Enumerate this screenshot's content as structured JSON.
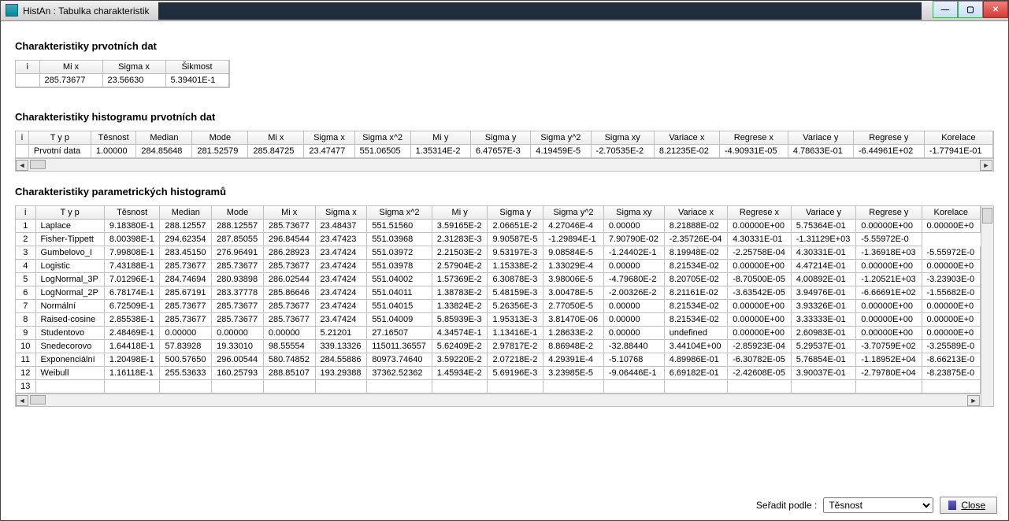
{
  "window": {
    "title": "HistAn : Tabulka charakteristik"
  },
  "sections": {
    "sec1_title": "Charakteristiky prvotních dat",
    "sec2_title": "Charakteristiky histogramu prvotních dat",
    "sec3_title": "Charakteristiky parametrických histogramů"
  },
  "table1": {
    "headers": [
      "i",
      "Mi x",
      "Sigma x",
      "Šikmost"
    ],
    "row": [
      "",
      "285.73677",
      "23.56630",
      "5.39401E-1"
    ]
  },
  "table2": {
    "headers": [
      "i",
      "T y p",
      "Těsnost",
      "Median",
      "Mode",
      "Mi x",
      "Sigma x",
      "Sigma x^2",
      "Mi y",
      "Sigma y",
      "Sigma y^2",
      "Sigma xy",
      "Variace x",
      "Regrese x",
      "Variace y",
      "Regrese y",
      "Korelace"
    ],
    "row": [
      "",
      "Prvotní data",
      "1.00000",
      "284.85648",
      "281.52579",
      "285.84725",
      "23.47477",
      "551.06505",
      "1.35314E-2",
      "6.47657E-3",
      "4.19459E-5",
      "-2.70535E-2",
      "8.21235E-02",
      "-4.90931E-05",
      "4.78633E-01",
      "-6.44961E+02",
      "-1.77941E-01"
    ]
  },
  "table3": {
    "headers": [
      "i",
      "T y p",
      "Těsnost",
      "Median",
      "Mode",
      "Mi x",
      "Sigma x",
      "Sigma x^2",
      "Mi y",
      "Sigma y",
      "Sigma y^2",
      "Sigma xy",
      "Variace x",
      "Regrese x",
      "Variace y",
      "Regrese y",
      "Korelace"
    ],
    "rows": [
      [
        "1",
        "Laplace",
        "9.18380E-1",
        "288.12557",
        "288.12557",
        "285.73677",
        "23.48437",
        "551.51560",
        "3.59165E-2",
        "2.06651E-2",
        "4.27046E-4",
        "0.00000",
        "8.21888E-02",
        "0.00000E+00",
        "5.75364E-01",
        "0.00000E+00",
        "0.00000E+0"
      ],
      [
        "2",
        "Fisher-Tippett",
        "8.00398E-1",
        "294.62354",
        "287.85055",
        "296.84544",
        "23.47423",
        "551.03968",
        "2.31283E-3",
        "9.90587E-5",
        "-1.29894E-1",
        "7.90790E-02",
        "-2.35726E-04",
        "4.30331E-01",
        "-1.31129E+03",
        "-5.55972E-0"
      ],
      [
        "3",
        "Gumbelovo_I",
        "7.99808E-1",
        "283.45150",
        "276.96491",
        "286.28923",
        "23.47424",
        "551.03972",
        "2.21503E-2",
        "9.53197E-3",
        "9.08584E-5",
        "-1.24402E-1",
        "8.19948E-02",
        "-2.25758E-04",
        "4.30331E-01",
        "-1.36918E+03",
        "-5.55972E-0"
      ],
      [
        "4",
        "Logistic",
        "7.43188E-1",
        "285.73677",
        "285.73677",
        "285.73677",
        "23.47424",
        "551.03978",
        "2.57904E-2",
        "1.15338E-2",
        "1.33029E-4",
        "0.00000",
        "8.21534E-02",
        "0.00000E+00",
        "4.47214E-01",
        "0.00000E+00",
        "0.00000E+0"
      ],
      [
        "5",
        "LogNormal_3P",
        "7.01296E-1",
        "284.74694",
        "280.93898",
        "286.02544",
        "23.47424",
        "551.04002",
        "1.57369E-2",
        "6.30878E-3",
        "3.98006E-5",
        "-4.79680E-2",
        "8.20705E-02",
        "-8.70500E-05",
        "4.00892E-01",
        "-1.20521E+03",
        "-3.23903E-0"
      ],
      [
        "6",
        "LogNormal_2P",
        "6.78174E-1",
        "285.67191",
        "283.37778",
        "285.86646",
        "23.47424",
        "551.04011",
        "1.38783E-2",
        "5.48159E-3",
        "3.00478E-5",
        "-2.00326E-2",
        "8.21161E-02",
        "-3.63542E-05",
        "3.94976E-01",
        "-6.66691E+02",
        "-1.55682E-0"
      ],
      [
        "7",
        "Normální",
        "6.72509E-1",
        "285.73677",
        "285.73677",
        "285.73677",
        "23.47424",
        "551.04015",
        "1.33824E-2",
        "5.26356E-3",
        "2.77050E-5",
        "0.00000",
        "8.21534E-02",
        "0.00000E+00",
        "3.93326E-01",
        "0.00000E+00",
        "0.00000E+0"
      ],
      [
        "8",
        "Raised-cosine",
        "2.85538E-1",
        "285.73677",
        "285.73677",
        "285.73677",
        "23.47424",
        "551.04009",
        "5.85939E-3",
        "1.95313E-3",
        "3.81470E-06",
        "0.00000",
        "8.21534E-02",
        "0.00000E+00",
        "3.33333E-01",
        "0.00000E+00",
        "0.00000E+0"
      ],
      [
        "9",
        "Studentovo",
        "2.48469E-1",
        "0.00000",
        "0.00000",
        "0.00000",
        "5.21201",
        "27.16507",
        "4.34574E-1",
        "1.13416E-1",
        "1.28633E-2",
        "0.00000",
        "undefined",
        "0.00000E+00",
        "2.60983E-01",
        "0.00000E+00",
        "0.00000E+0"
      ],
      [
        "10",
        "Snedecorovo",
        "1.64418E-1",
        "57.83928",
        "19.33010",
        "98.55554",
        "339.13326",
        "115011.36557",
        "5.62409E-2",
        "2.97817E-2",
        "8.86948E-2",
        "-32.88440",
        "3.44104E+00",
        "-2.85923E-04",
        "5.29537E-01",
        "-3.70759E+02",
        "-3.25589E-0"
      ],
      [
        "11",
        "Exponenciální",
        "1.20498E-1",
        "500.57650",
        "296.00544",
        "580.74852",
        "284.55886",
        "80973.74640",
        "3.59220E-2",
        "2.07218E-2",
        "4.29391E-4",
        "-5.10768",
        "4.89986E-01",
        "-6.30782E-05",
        "5.76854E-01",
        "-1.18952E+04",
        "-8.66213E-0"
      ],
      [
        "12",
        "Weibull",
        "1.16118E-1",
        "255.53633",
        "160.25793",
        "288.85107",
        "193.29388",
        "37362.52362",
        "1.45934E-2",
        "5.69196E-3",
        "3.23985E-5",
        "-9.06446E-1",
        "6.69182E-01",
        "-2.42608E-05",
        "3.90037E-01",
        "-2.79780E+04",
        "-8.23875E-0"
      ],
      [
        "13",
        "",
        "",
        "",
        "",
        "",
        "",
        "",
        "",
        "",
        "",
        "",
        "",
        "",
        "",
        "",
        ""
      ]
    ]
  },
  "footer": {
    "sort_label": "Seřadit podle :",
    "sort_value": "Těsnost",
    "close_label": "Close"
  }
}
